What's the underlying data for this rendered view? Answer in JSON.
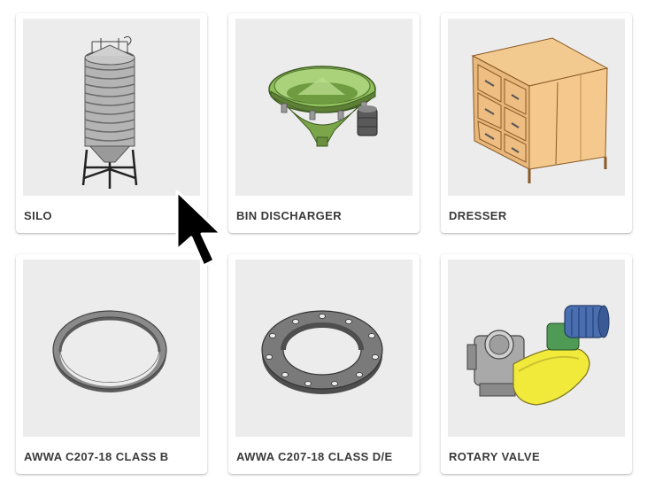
{
  "products": [
    {
      "label": "SILO",
      "icon": "silo-icon"
    },
    {
      "label": "BIN DISCHARGER",
      "icon": "bin-discharger-icon"
    },
    {
      "label": "DRESSER",
      "icon": "dresser-icon"
    },
    {
      "label": "AWWA C207-18 CLASS B",
      "icon": "flat-ring-icon"
    },
    {
      "label": "AWWA C207-18 CLASS D/E",
      "icon": "flange-icon"
    },
    {
      "label": "ROTARY VALVE",
      "icon": "rotary-valve-icon"
    }
  ],
  "colors": {
    "thumb_bg": "#ececec",
    "silo_grey": "#a8a8a8",
    "discharger_green": "#8fbf5a",
    "dresser_wood": "#e8b77c",
    "ring_grey": "#8a8a8a",
    "valve_yellow": "#f2ea3a",
    "motor_blue": "#4a6fb0"
  }
}
